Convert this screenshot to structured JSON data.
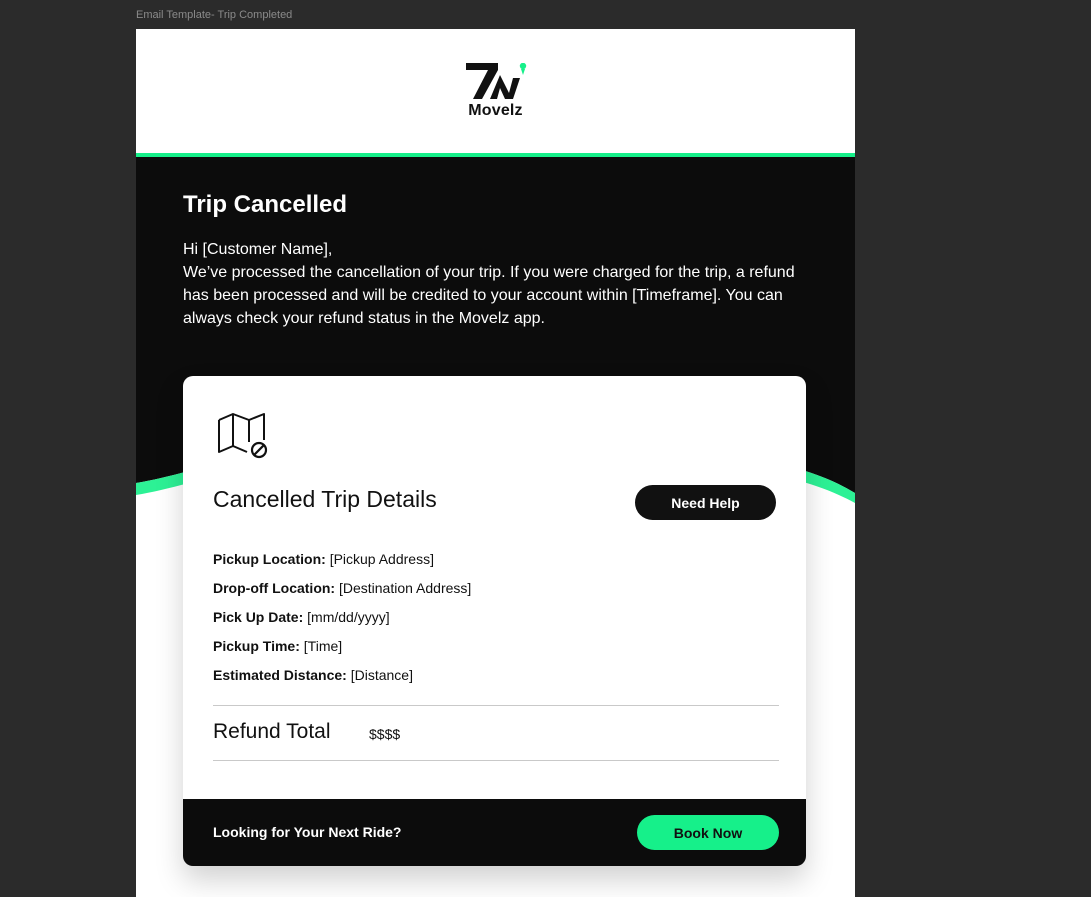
{
  "frame_label": "Email Template- Trip Completed",
  "brand": {
    "name": "Movelz",
    "accent_color": "#16f08a",
    "dark_color": "#0c0c0c"
  },
  "hero": {
    "title": "Trip Cancelled",
    "greeting": "Hi [Customer Name],",
    "body": "We’ve processed the cancellation of your trip. If you were charged for the trip, a refund has been processed and will be credited to your account within [Timeframe]. You can always check your refund status in the Movelz app."
  },
  "card": {
    "icon": "map-cancelled-icon",
    "title": "Cancelled Trip Details",
    "help_button": "Need Help",
    "details": [
      {
        "label": "Pickup Location:",
        "value": "[Pickup Address]"
      },
      {
        "label": "Drop-off Location:",
        "value": "[Destination Address]"
      },
      {
        "label": "Pick Up Date:",
        "value": "[mm/dd/yyyy]"
      },
      {
        "label": "Pickup Time:",
        "value": "[Time]"
      },
      {
        "label": "Estimated Distance:",
        "value": "[Distance]"
      }
    ],
    "refund_label": "Refund Total",
    "refund_value": "$$$$",
    "footer_text": "Looking for Your Next Ride?",
    "book_button": "Book Now"
  }
}
